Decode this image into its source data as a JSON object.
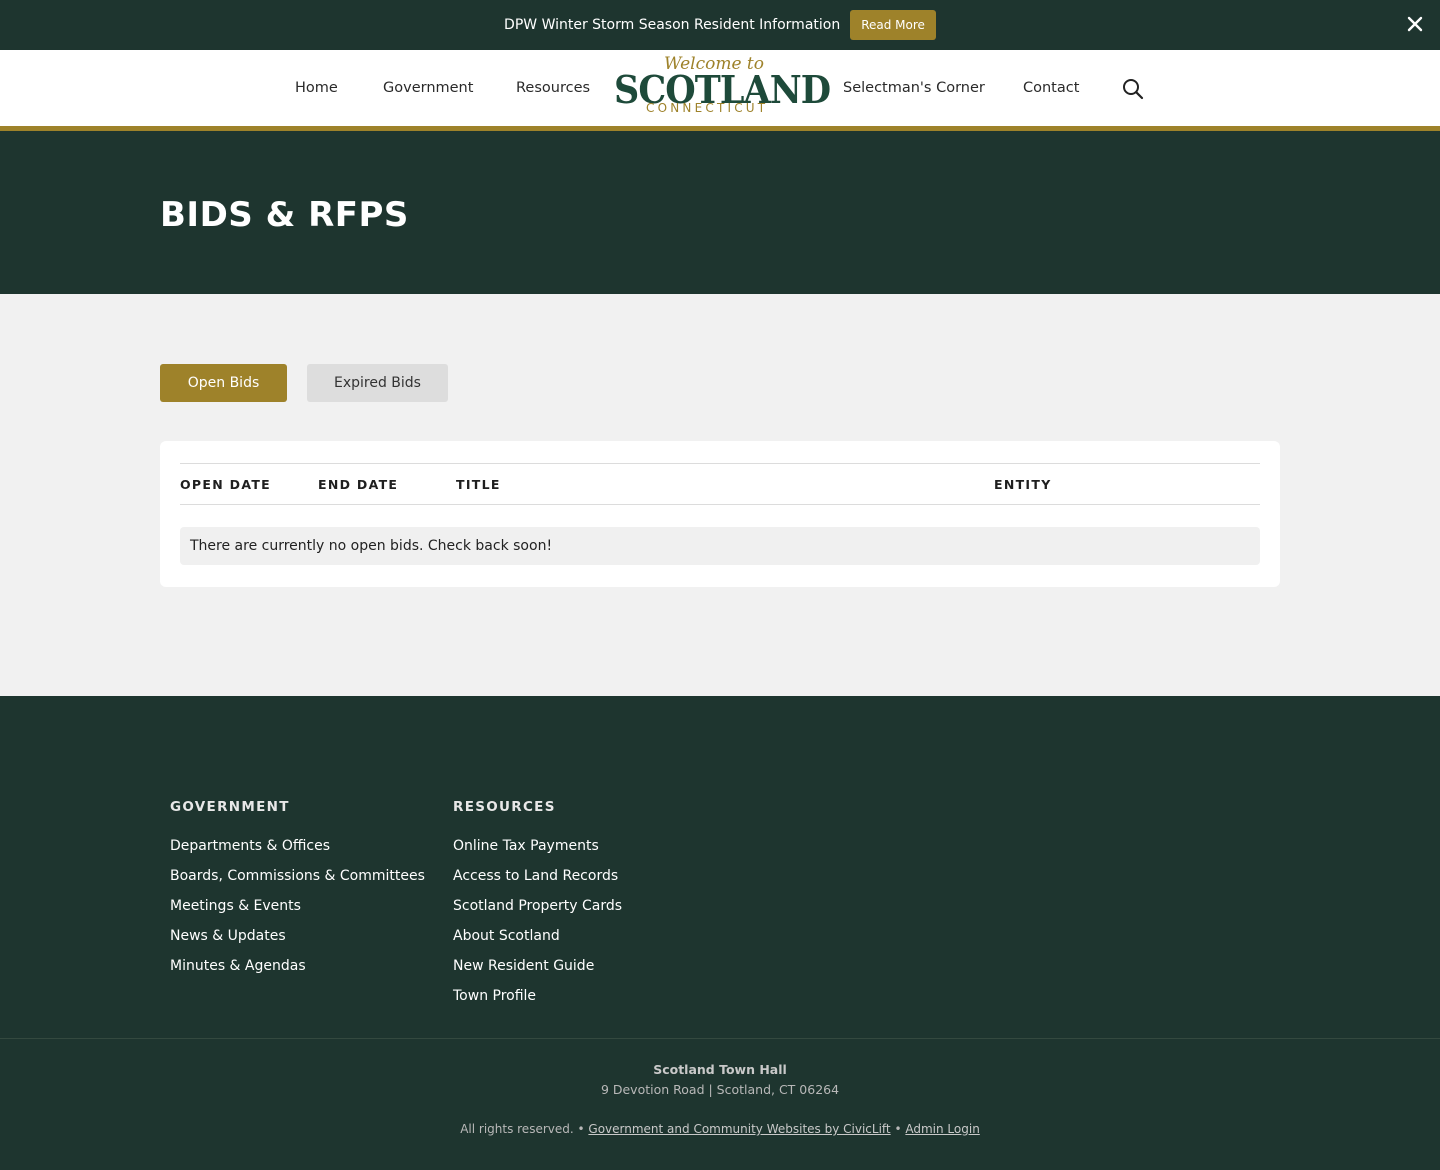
{
  "alert": {
    "text": "DPW Winter Storm Season Resident Information",
    "button": "Read More"
  },
  "nav": {
    "home": "Home",
    "government": "Government",
    "resources": "Resources",
    "selectman": "Selectman's Corner",
    "contact": "Contact"
  },
  "logo": {
    "welcome": "Welcome to",
    "name": "SCOTLAND",
    "state": "CONNECTICUT"
  },
  "hero": {
    "title": "BIDS & RFPS"
  },
  "tabs": {
    "open": "Open Bids",
    "expired": "Expired Bids"
  },
  "table": {
    "headers": [
      "OPEN DATE",
      "END DATE",
      "TITLE",
      "ENTITY"
    ],
    "empty_message": "There are currently no open bids. Check back soon!"
  },
  "footer": {
    "government": {
      "heading": "GOVERNMENT",
      "links": [
        "Departments & Offices",
        "Boards, Commissions & Committees",
        "Meetings & Events",
        "News & Updates",
        "Minutes & Agendas"
      ]
    },
    "resources": {
      "heading": "RESOURCES",
      "links": [
        "Online Tax Payments",
        "Access to Land Records",
        "Scotland Property Cards",
        "About Scotland",
        "New Resident Guide",
        "Town Profile"
      ]
    },
    "address": {
      "name": "Scotland Town Hall",
      "line": "9 Devotion Road | Scotland, CT  06264"
    },
    "legal": {
      "rights": "All rights reserved. •",
      "credit": "Government and Community Websites by CivicLift",
      "sep": "•",
      "admin": "Admin Login"
    }
  },
  "colors": {
    "dark_green": "#1e352f",
    "gold": "#9e822a",
    "page_bg": "#f1f1f1"
  }
}
